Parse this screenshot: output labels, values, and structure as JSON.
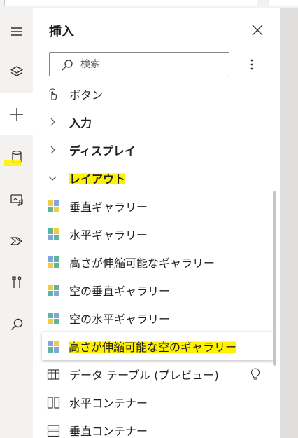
{
  "panel": {
    "title": "挿入",
    "search_placeholder": "検索"
  },
  "rail": {
    "items": [
      {
        "icon": "hamburger-icon"
      },
      {
        "icon": "layers-icon"
      },
      {
        "icon": "add-icon",
        "active": true
      },
      {
        "icon": "data-icon",
        "highlighted": true
      },
      {
        "icon": "media-icon"
      },
      {
        "icon": "power-automate-icon"
      },
      {
        "icon": "tools-icon"
      },
      {
        "icon": "search-icon"
      }
    ]
  },
  "list": {
    "partial_item": "ボタン",
    "groups": [
      {
        "label": "入力",
        "expanded": false
      },
      {
        "label": "ディスプレイ",
        "expanded": false
      },
      {
        "label": "レイアウト",
        "expanded": true,
        "highlighted": true
      }
    ],
    "layout_items": [
      {
        "label": "垂直ギャラリー",
        "icon": "gallery-icon"
      },
      {
        "label": "水平ギャラリー",
        "icon": "gallery-icon"
      },
      {
        "label": "高さが伸縮可能なギャラリー",
        "icon": "gallery-icon"
      },
      {
        "label": "空の垂直ギャラリー",
        "icon": "gallery-icon"
      },
      {
        "label": "空の水平ギャラリー",
        "icon": "gallery-icon"
      },
      {
        "label": "高さが伸縮可能な空のギャラリー",
        "icon": "gallery-icon",
        "selected": true,
        "highlighted": true
      },
      {
        "label": "データ テーブル (プレビュー)",
        "icon": "table-icon",
        "badge": "lightbulb-icon"
      },
      {
        "label": "水平コンテナー",
        "icon": "horizontal-container-icon"
      },
      {
        "label": "垂直コンテナー",
        "icon": "vertical-container-icon"
      }
    ]
  },
  "colors": {
    "highlight": "#fff200",
    "gallery_green": "#5fb49c",
    "gallery_yellow": "#f2c94c",
    "gallery_blue": "#7fa7d9"
  }
}
